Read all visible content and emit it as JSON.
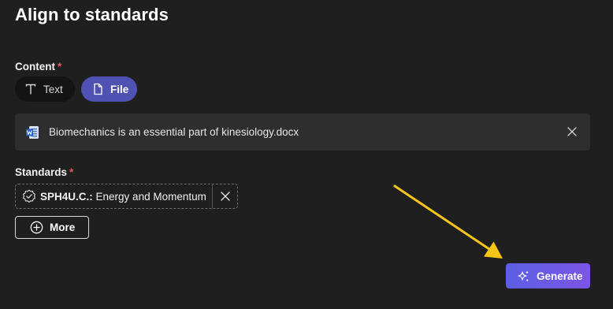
{
  "page": {
    "title": "Align to standards"
  },
  "content": {
    "label": "Content",
    "required_marker": "*",
    "options": [
      {
        "label": "Text",
        "icon": "text-icon",
        "selected": false
      },
      {
        "label": "File",
        "icon": "file-icon",
        "selected": true
      }
    ],
    "file": {
      "name": "Biomechanics is an essential part of kinesiology.docx",
      "icon": "word-document-icon"
    }
  },
  "standards": {
    "label": "Standards",
    "required_marker": "*",
    "items": [
      {
        "code": "SPH4U.C.:",
        "name": "Energy and Momentum"
      }
    ],
    "more_label": "More"
  },
  "actions": {
    "generate_label": "Generate"
  },
  "colors": {
    "background": "#1f1f1f",
    "accent": "#4f52b2",
    "generate_gradient_start": "#5b5fe3",
    "generate_gradient_end": "#7b55e6",
    "required": "#e0595f",
    "annotation_arrow": "#f5c518"
  }
}
